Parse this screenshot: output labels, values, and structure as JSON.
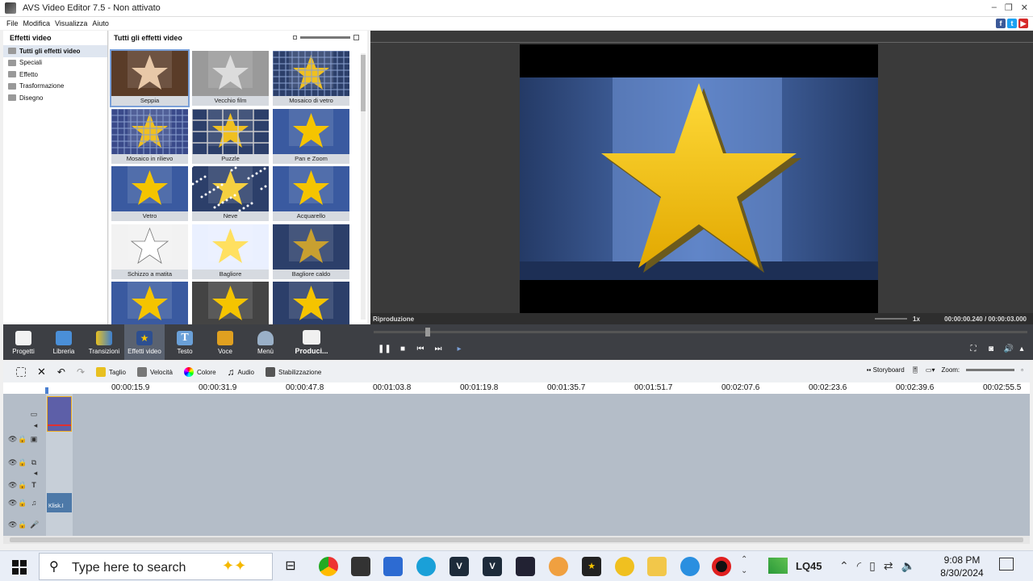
{
  "window": {
    "title": "AVS Video Editor 7.5 - Non attivato"
  },
  "menu": [
    "File",
    "Modifica",
    "Visualizza",
    "Aiuto"
  ],
  "categories": {
    "header": "Effetti video",
    "items": [
      "Tutti gli effetti video",
      "Speciali",
      "Effetto",
      "Trasformazione",
      "Disegno"
    ],
    "selected": 0
  },
  "effects": {
    "header": "Tutti gli effetti video",
    "tiles": [
      "Seppia",
      "Vecchio film",
      "Mosaico di vetro",
      "Mosaico in rilievo",
      "Puzzle",
      "Pan e Zoom",
      "Vetro",
      "Neve",
      "Acquarello",
      "Schizzo a matita",
      "Bagliore",
      "Bagliore caldo",
      "",
      "",
      ""
    ],
    "selected": 0
  },
  "preview": {
    "label": "Riproduzione",
    "speed": "1x",
    "time": "00:00:00.240 / 00:00:03.000"
  },
  "toolbar": {
    "buttons": [
      "Progetti",
      "Libreria",
      "Transizioni",
      "Effetti video",
      "Testo",
      "Voce",
      "Menù"
    ],
    "produce": "Produci...",
    "active": 3
  },
  "timeline_tools": {
    "cut": "Taglio",
    "speed": "Velocità",
    "color": "Colore",
    "audio": "Audio",
    "stabilize": "Stabilizzazione",
    "storyboard": "Storyboard",
    "zoom": "Zoom:"
  },
  "ruler": [
    "00:00:15.9",
    "00:00:31.9",
    "00:00:47.8",
    "00:01:03.8",
    "00:01:19.8",
    "00:01:35.7",
    "00:01:51.7",
    "00:02:07.6",
    "00:02:23.6",
    "00:02:39.6",
    "00:02:55.5"
  ],
  "audio_clip_label": "Klisk.I",
  "taskbar": {
    "search_placeholder": "Type here to search",
    "weather": "LQ45",
    "time": "9:08 PM",
    "date": "8/30/2024"
  },
  "colors": {
    "accent": "#7aa0d8",
    "toolbar_dark": "#3d3f44",
    "timeline": "#b4bdc8",
    "star": "#f5c400"
  }
}
